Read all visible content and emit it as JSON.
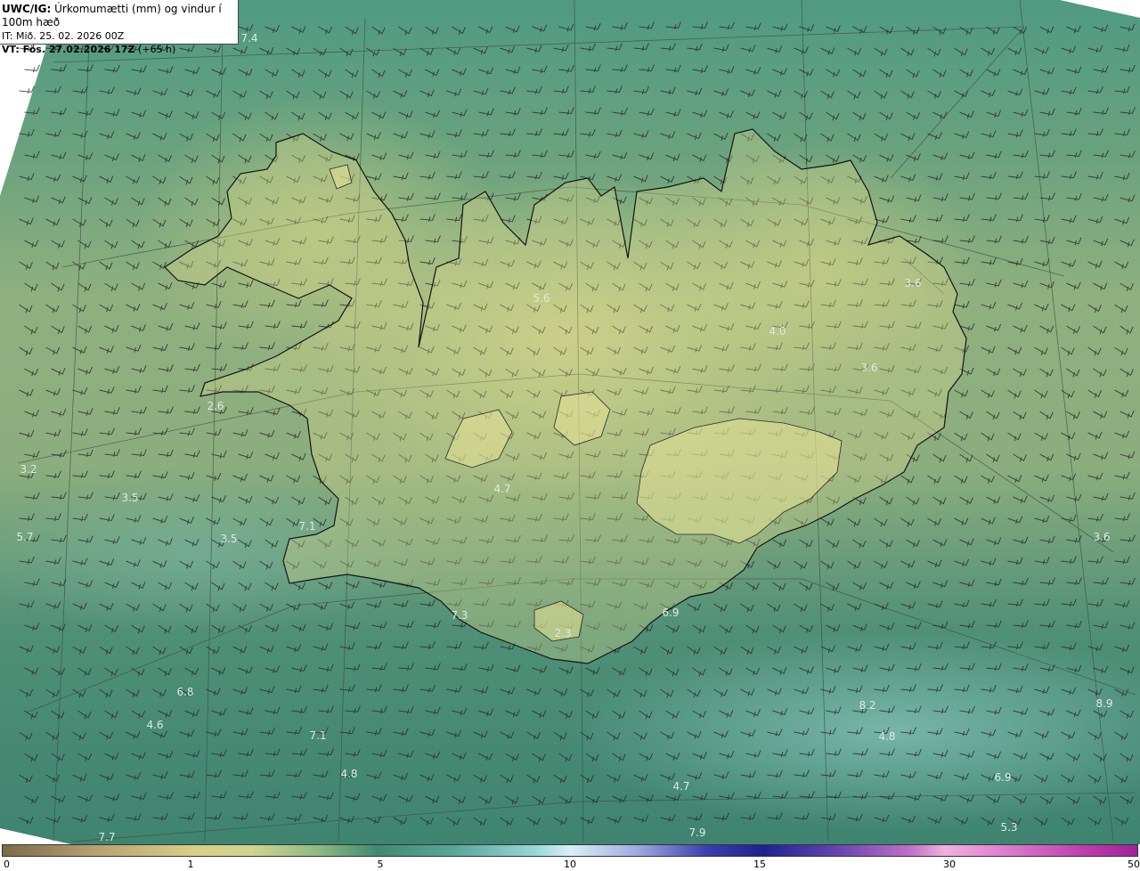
{
  "header": {
    "product": "UWC/IG:",
    "title": "Úrkomumætti (mm) og vindur í 100m hæð",
    "init_time": "IT: Mið. 25. 02. 2026 00Z",
    "valid_label": "VT: Fös. 27.02.2026 17Z",
    "lead": "(+65 h)"
  },
  "map_values": [
    "7.4",
    "5.6",
    "4.0",
    "3.6",
    "3.6",
    "2.6",
    "3.2",
    "3.5",
    "5.7",
    "3.5",
    "7.1",
    "4.7",
    "7.3",
    "2.3",
    "6.9",
    "6.8",
    "4.6",
    "7.1",
    "4.8",
    "8.2",
    "4.8",
    "8.9",
    "4.7",
    "7.7",
    "7.9",
    "5.3",
    "3.6",
    "6.9"
  ],
  "colorbar": {
    "ticks": [
      "0",
      "1",
      "5",
      "10",
      "15",
      "30",
      "50"
    ]
  },
  "colors": {
    "land_high": "#d6d68a",
    "sea_mid": "#4f9a82",
    "sea_light": "#8cc8be",
    "coast": "#1a1a1a"
  }
}
